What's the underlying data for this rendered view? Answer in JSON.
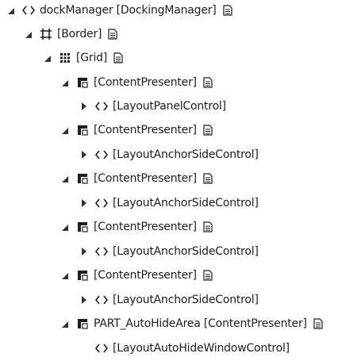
{
  "tree": {
    "nodes": [
      {
        "label": "dockManager [DockingManager]",
        "icon": "code-brackets-icon",
        "toggle": "expanded",
        "has_doc_icon": true
      },
      {
        "label": "[Border]",
        "icon": "border-icon",
        "toggle": "expanded",
        "has_doc_icon": true
      },
      {
        "label": "[Grid]",
        "icon": "grid-icon",
        "toggle": "expanded",
        "has_doc_icon": true
      },
      {
        "label": "[ContentPresenter]",
        "icon": "content-presenter-icon",
        "toggle": "expanded",
        "has_doc_icon": true
      },
      {
        "label": "[LayoutPanelControl]",
        "icon": "code-brackets-icon",
        "toggle": "collapsed",
        "has_doc_icon": false
      },
      {
        "label": "[ContentPresenter]",
        "icon": "content-presenter-icon",
        "toggle": "expanded",
        "has_doc_icon": true
      },
      {
        "label": "[LayoutAnchorSideControl]",
        "icon": "code-brackets-icon",
        "toggle": "collapsed",
        "has_doc_icon": false
      },
      {
        "label": "[ContentPresenter]",
        "icon": "content-presenter-icon",
        "toggle": "expanded",
        "has_doc_icon": true
      },
      {
        "label": "[LayoutAnchorSideControl]",
        "icon": "code-brackets-icon",
        "toggle": "collapsed",
        "has_doc_icon": false
      },
      {
        "label": "[ContentPresenter]",
        "icon": "content-presenter-icon",
        "toggle": "expanded",
        "has_doc_icon": true
      },
      {
        "label": "[LayoutAnchorSideControl]",
        "icon": "code-brackets-icon",
        "toggle": "collapsed",
        "has_doc_icon": false
      },
      {
        "label": "[ContentPresenter]",
        "icon": "content-presenter-icon",
        "toggle": "expanded",
        "has_doc_icon": true
      },
      {
        "label": "[LayoutAnchorSideControl]",
        "icon": "code-brackets-icon",
        "toggle": "collapsed",
        "has_doc_icon": false
      },
      {
        "label": "PART_AutoHideArea [ContentPresenter]",
        "icon": "content-presenter-icon",
        "toggle": "expanded",
        "has_doc_icon": true
      },
      {
        "label": "[LayoutAutoHideWindowControl]",
        "icon": "code-brackets-icon",
        "toggle": "none",
        "has_doc_icon": false
      }
    ]
  }
}
